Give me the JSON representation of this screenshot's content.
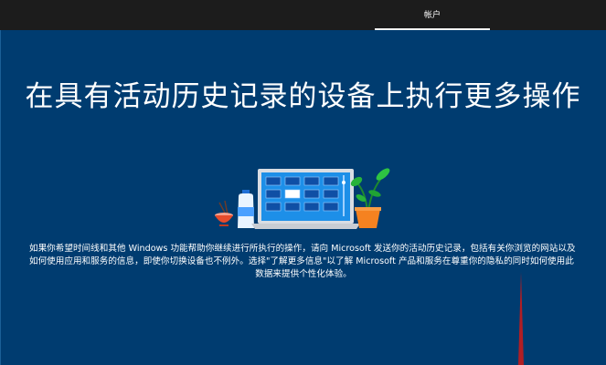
{
  "tabs": {
    "account": "帐户"
  },
  "main": {
    "title": "在具有活动历史记录的设备上执行更多操作",
    "desc_line1": "如果你希望时间线和其他 Windows 功能帮助你继续进行所执行的操作，请向 Microsoft 发送你的活动历史记录，包括有关你浏览的网站以及",
    "desc_line2": "如何使用应用和服务的信息，即使你切换设备也不例外。选择\"了解更多信息\"以了解 Microsoft 产品和服务在尊重你的隐私的同时如何使用此",
    "desc_line3": "数据来提供个性化体验。"
  }
}
